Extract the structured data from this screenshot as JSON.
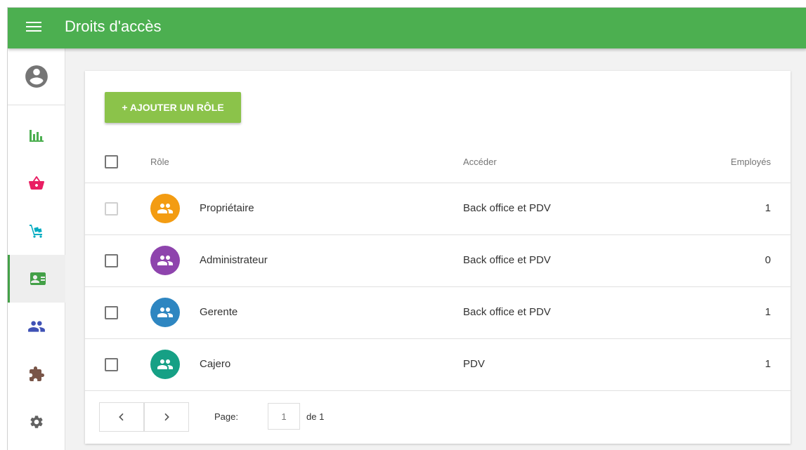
{
  "header": {
    "title": "Droits d'accès",
    "menu_icon": "hamburger-menu-icon"
  },
  "sidebar": {
    "items": [
      {
        "icon": "account-circle-icon",
        "color": "#757575"
      },
      {
        "icon": "bar-chart-icon",
        "color": "#4caf50"
      },
      {
        "icon": "shopping-basket-icon",
        "color": "#e91e63"
      },
      {
        "icon": "inventory-cart-icon",
        "color": "#00acc1"
      },
      {
        "icon": "employee-card-icon",
        "color": "#43a047",
        "active": true
      },
      {
        "icon": "customers-icon",
        "color": "#3f51b5"
      },
      {
        "icon": "integrations-puzzle-icon",
        "color": "#795548"
      },
      {
        "icon": "settings-gear-icon",
        "color": "#616161"
      }
    ]
  },
  "toolbar": {
    "add_role_label": "+ AJOUTER UN RÔLE"
  },
  "table": {
    "headers": {
      "role": "Rôle",
      "access": "Accéder",
      "employees": "Employés"
    },
    "rows": [
      {
        "role": "Propriétaire",
        "access": "Back office et PDV",
        "employees": "1",
        "avatar_color": "#f39c12",
        "checkbox_disabled": true
      },
      {
        "role": "Administrateur",
        "access": "Back office et PDV",
        "employees": "0",
        "avatar_color": "#8e44ad"
      },
      {
        "role": "Gerente",
        "access": "Back office et PDV",
        "employees": "1",
        "avatar_color": "#2e86c1"
      },
      {
        "role": "Cajero",
        "access": "PDV",
        "employees": "1",
        "avatar_color": "#16a085"
      }
    ]
  },
  "pagination": {
    "page_label": "Page:",
    "current_page": "1",
    "of_label": "de 1",
    "prev_icon": "chevron-left-icon",
    "next_icon": "chevron-right-icon"
  }
}
